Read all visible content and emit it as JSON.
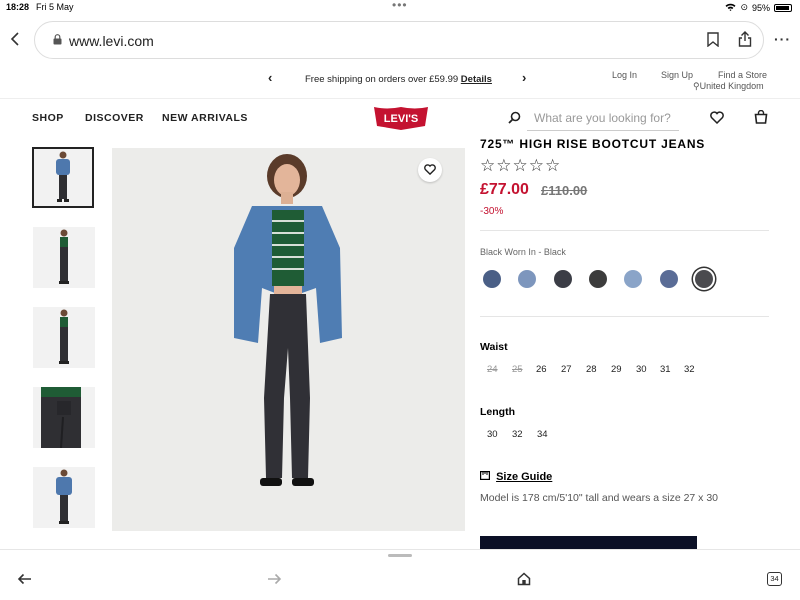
{
  "status": {
    "time": "18:28",
    "date": "Fri 5 May",
    "battery": "95%"
  },
  "browser": {
    "url": "www.levi.com",
    "tab_count": "34"
  },
  "promo": {
    "message": "Free shipping on orders over £59.99 ",
    "details": "Details"
  },
  "account": {
    "login": "Log In",
    "signup": "Sign Up",
    "find_store": "Find a Store",
    "country": "United Kingdom"
  },
  "nav": {
    "shop": "SHOP",
    "discover": "DISCOVER",
    "new_arrivals": "NEW ARRIVALS",
    "logo": "LEVI'S"
  },
  "search": {
    "placeholder": "What are you looking for?"
  },
  "product": {
    "title": "725™ HIGH RISE BOOTCUT JEANS",
    "stars": "☆☆☆☆☆",
    "price": "£77.00",
    "old_price": "£110.00",
    "discount": "-30%",
    "color_name": "Black Worn In - Black",
    "swatches": [
      "#4a5f86",
      "#7d96bd",
      "#3b3d46",
      "#3c3c3c",
      "#8aa4c8",
      "#5a6c96",
      "#4a4a4e"
    ],
    "waist_label": "Waist",
    "waist_sizes": [
      {
        "label": "24",
        "available": false
      },
      {
        "label": "25",
        "available": false
      },
      {
        "label": "26",
        "available": true
      },
      {
        "label": "27",
        "available": true
      },
      {
        "label": "28",
        "available": true
      },
      {
        "label": "29",
        "available": true
      },
      {
        "label": "30",
        "available": true
      },
      {
        "label": "31",
        "available": true
      },
      {
        "label": "32",
        "available": true
      }
    ],
    "length_label": "Length",
    "length_sizes": [
      "30",
      "32",
      "34"
    ],
    "size_guide": "Size Guide",
    "model_info": "Model is 178 cm/5'10\" tall and wears a size 27 x 30"
  },
  "colors": {
    "accent_red": "#c41230",
    "button_navy": "#0b1026"
  }
}
